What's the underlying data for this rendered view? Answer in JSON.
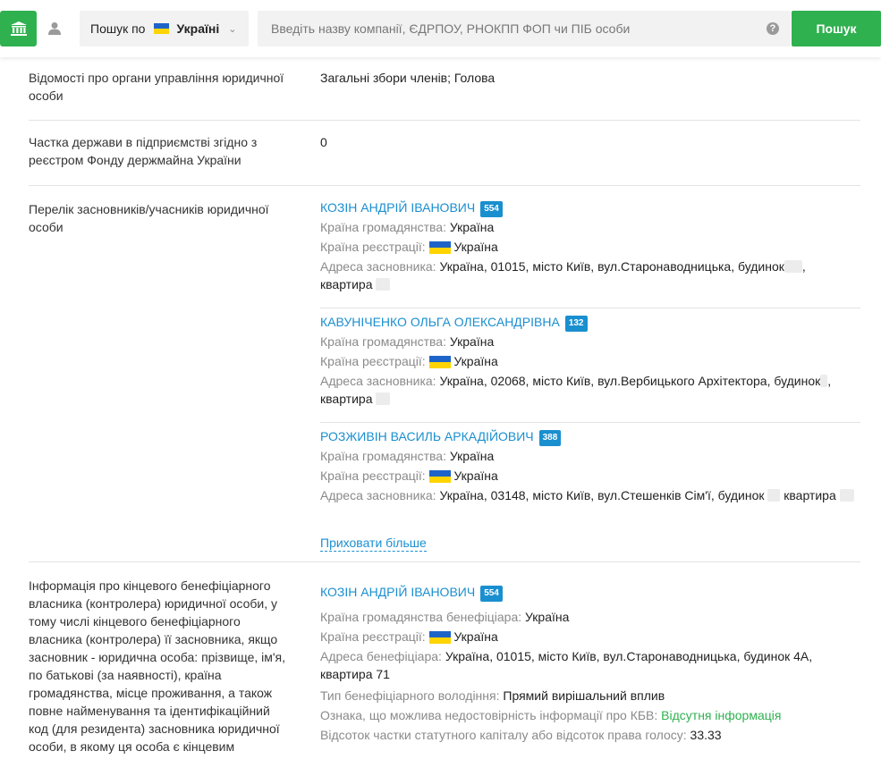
{
  "header": {
    "search_scope_label": "Пошук по",
    "search_country": "Україні",
    "search_placeholder": "Введіть назву компанії, ЄДРПОУ, РНОКПП ФОП чи ПІБ особи",
    "help_symbol": "?",
    "search_button": "Пошук"
  },
  "rows": {
    "management": {
      "label": "Відомості про органи управління юридичної особи",
      "value": "Загальні збори членів; Голова"
    },
    "state_share": {
      "label": "Частка держави в підприємстві згідно з реєстром Фонду держмайна України",
      "value": "0"
    },
    "founders": {
      "label": "Перелік засновників/учасників юридичної особи",
      "citizenship_label": "Країна громадянства:",
      "registration_label": "Країна реєстрації:",
      "address_label": "Адреса засновника:",
      "items": [
        {
          "name": "КОЗІН АНДРІЙ ІВАНОВИЧ",
          "badge": "554",
          "citizenship": "Україна",
          "registration": "Україна",
          "address_line1": "Україна, 01015, місто Київ, вул.Старонаводницька, будинок",
          "address_line1_end": ",",
          "address_line2": "квартира"
        },
        {
          "name": "КАВУНІЧЕНКО ОЛЬГА ОЛЕКСАНДРІВНА",
          "badge": "132",
          "citizenship": "Україна",
          "registration": "Україна",
          "address_line1": "Україна, 02068, місто Київ, вул.Вербицького Архітектора, будинок",
          "address_line1_end": ",",
          "address_line2": "квартира"
        },
        {
          "name": "РОЗЖИВІН ВАСИЛЬ АРКАДІЙОВИЧ",
          "badge": "388",
          "citizenship": "Україна",
          "registration": "Україна",
          "address_line1": "Україна, 03148, місто Київ, вул.Стешенків Сім'ї, будинок",
          "address_line1_mid": "квартира"
        }
      ],
      "hide_more": "Приховати більше"
    },
    "beneficiary": {
      "label": "Інформація про кінцевого бенефіціарного власника (контролера) юридичної особи, у тому числі кінцевого бенефіціарного власника (контролера) її засновника, якщо засновник - юридична особа: прізвище, ім'я, по батькові (за наявності), країна громадянства, місце проживання, а також повне найменування та ідентифікаційний код (для резидента) засновника юридичної особи, в якому ця особа є кінцевим",
      "name": "КОЗІН АНДРІЙ ІВАНОВИЧ",
      "badge": "554",
      "citizenship_label": "Країна громадянства бенефіціара:",
      "citizenship": "Україна",
      "registration_label": "Країна реєстрації:",
      "registration": "Україна",
      "address_label": "Адреса бенефіціара:",
      "address_line1": "Україна, 01015, місто Київ, вул.Старонаводницька, будинок 4А,",
      "address_line2": "квартира 71",
      "ownership_type_label": "Тип бенефіціарного володіння:",
      "ownership_type": "Прямий вирішальний вплив",
      "unreliability_label": "Ознака, що можлива недостовірність інформації про КБВ:",
      "unreliability_value": "Відсутня інформація",
      "share_label": "Відсоток частки статутного капіталу або відсоток права голосу:",
      "share_value": "33.33"
    }
  }
}
